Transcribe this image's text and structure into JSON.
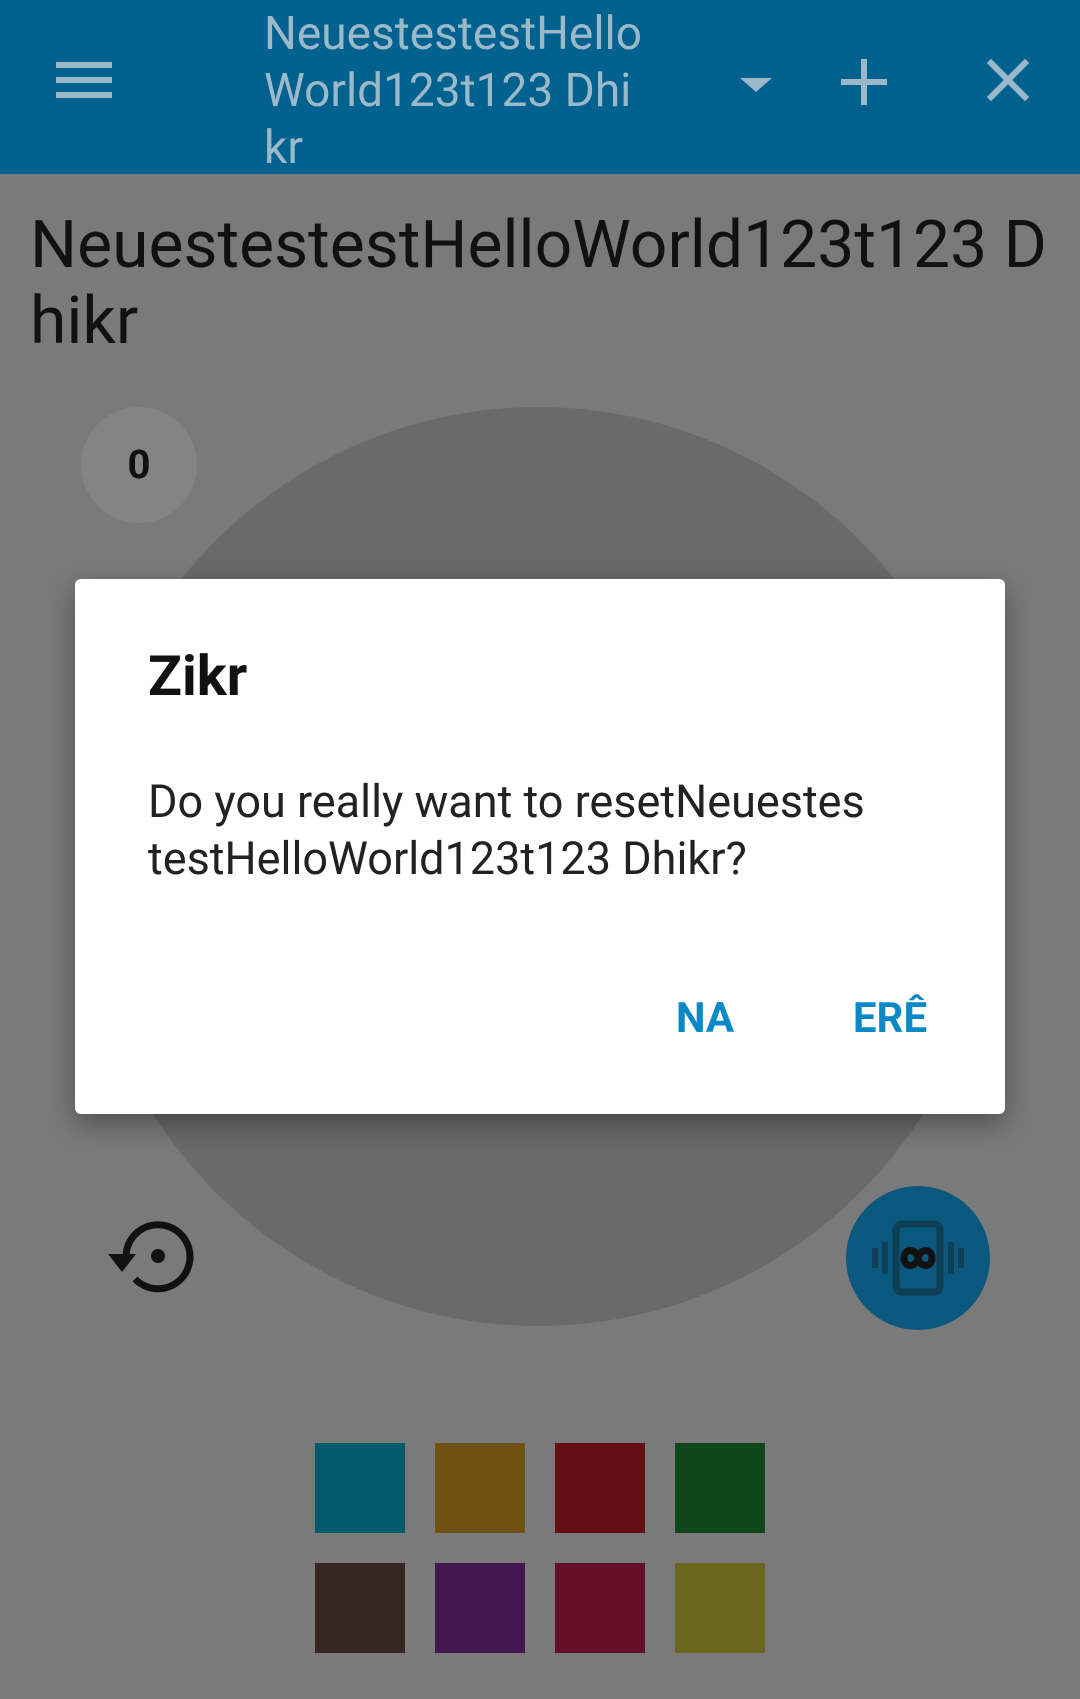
{
  "appbar": {
    "title": "NeuestestestHelloWorld123t123 Dhikr",
    "icons": {
      "menu": "menu-icon",
      "dropdown": "dropdown-arrow-icon",
      "add": "plus-icon",
      "close": "close-icon"
    },
    "background_color": "#01618f"
  },
  "main": {
    "title": "NeuestestestHelloWorld123t123 Dhikr",
    "counter_value": "0",
    "icons": {
      "reset": "reset-history-icon",
      "vibrate": "vibrate-infinity-icon"
    },
    "color_swatches": [
      {
        "name": "teal",
        "color": "#005a6a"
      },
      {
        "name": "amber",
        "color": "#6e5211"
      },
      {
        "name": "red",
        "color": "#640f13"
      },
      {
        "name": "green",
        "color": "#11461a"
      },
      {
        "name": "brown",
        "color": "#352622"
      },
      {
        "name": "purple",
        "color": "#43164f"
      },
      {
        "name": "pink",
        "color": "#640f2a"
      },
      {
        "name": "olive",
        "color": "#6b661f"
      }
    ]
  },
  "dialog": {
    "title": "Zikr",
    "message": "Do you really want to resetNeuestestestHelloWorld123t123 Dhikr?",
    "buttons": {
      "no": "NA",
      "yes": "ERÊ"
    },
    "accent_color": "#0a89c6"
  }
}
